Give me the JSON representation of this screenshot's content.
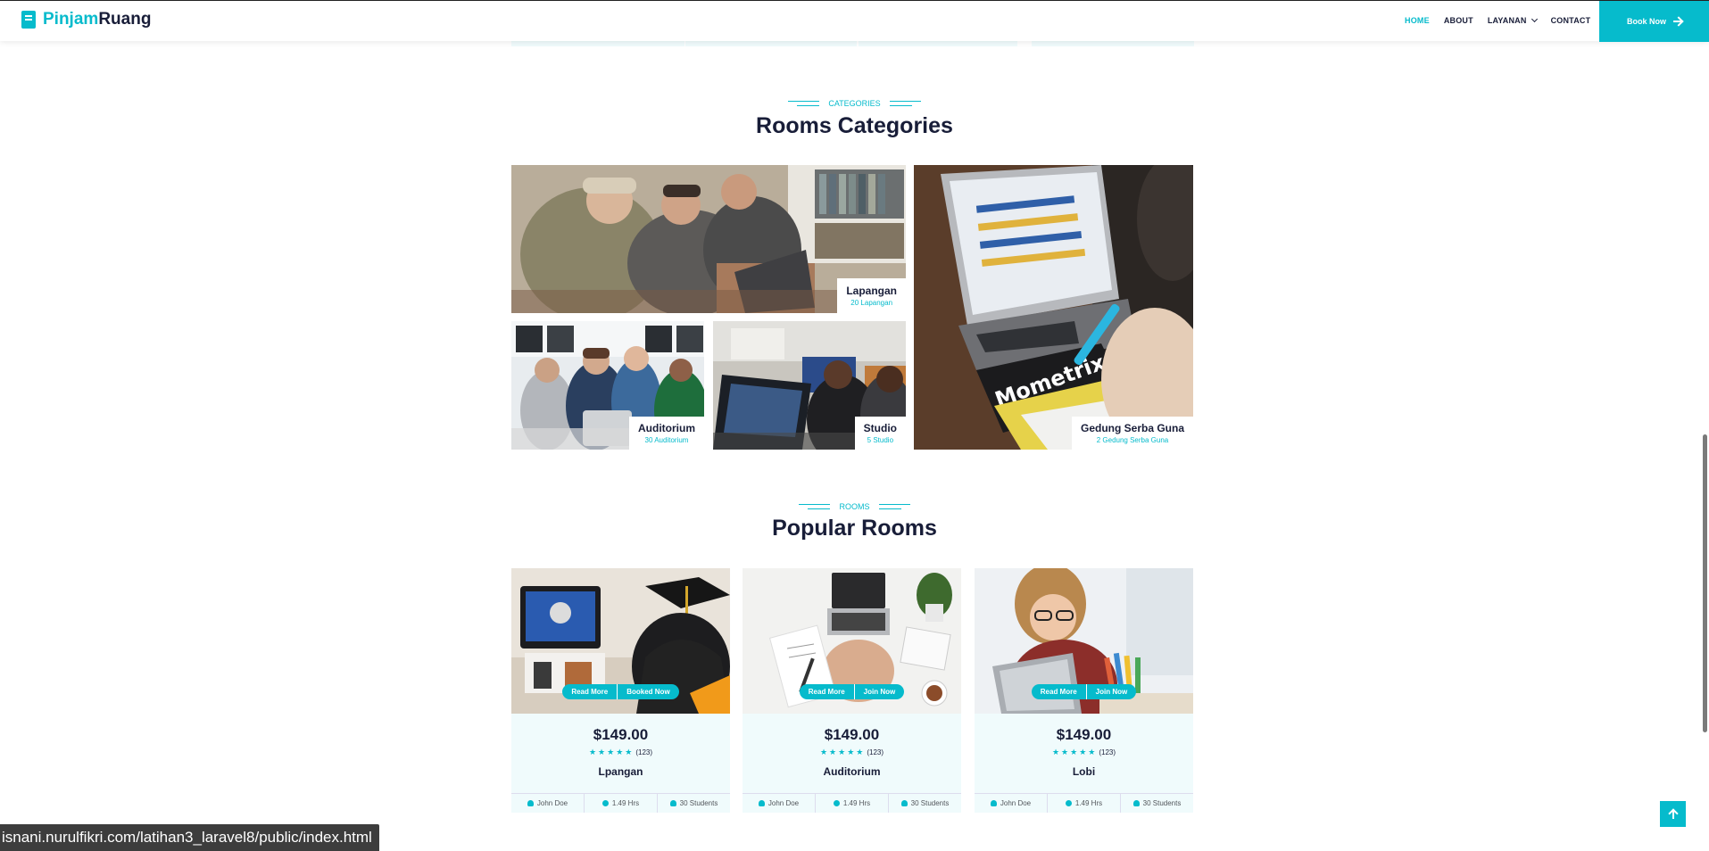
{
  "brand": {
    "part1": "Pinjam",
    "part2": "Ruang"
  },
  "nav": {
    "items": [
      "HOME",
      "ABOUT",
      "LAYANAN",
      "CONTACT"
    ],
    "book_label": "Book Now"
  },
  "categories_section": {
    "subtitle": "CATEGORIES",
    "title": "Rooms Categories",
    "items": [
      {
        "name": "Lapangan",
        "count": "20 Lapangan"
      },
      {
        "name": "Auditorium",
        "count": "30 Auditorium"
      },
      {
        "name": "Studio",
        "count": "5 Studio"
      },
      {
        "name": "Gedung Serba Guna",
        "count": "2 Gedung Serba Guna"
      }
    ]
  },
  "rooms_section": {
    "subtitle": "ROOMS",
    "title": "Popular Rooms",
    "cards": [
      {
        "btn_left": "Read More",
        "btn_right": "Booked Now",
        "price": "$149.00",
        "reviews": "(123)",
        "name": "Lpangan",
        "owner": "John Doe",
        "hours": "1.49 Hrs",
        "students": "30 Students",
        "rating": 5
      },
      {
        "btn_left": "Read More",
        "btn_right": "Join Now",
        "price": "$149.00",
        "reviews": "(123)",
        "name": "Auditorium",
        "owner": "John Doe",
        "hours": "1.49 Hrs",
        "students": "30 Students",
        "rating": 5
      },
      {
        "btn_left": "Read More",
        "btn_right": "Join Now",
        "price": "$149.00",
        "reviews": "(123)",
        "name": "Lobi",
        "owner": "John Doe",
        "hours": "1.49 Hrs",
        "students": "30 Students",
        "rating": 5
      }
    ]
  },
  "status_url": "isnani.nurulfikri.com/latihan3_laravel8/public/index.html",
  "colors": {
    "accent": "#06bbcc",
    "dark": "#181d38",
    "light_bg": "#f0fbfc"
  }
}
